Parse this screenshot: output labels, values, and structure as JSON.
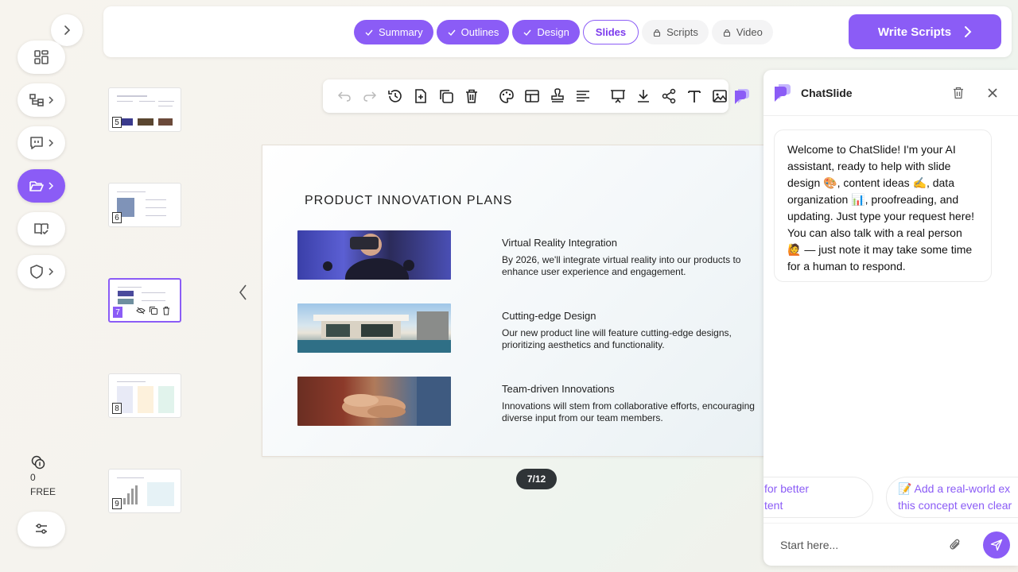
{
  "rail": {
    "credits_count": "0",
    "plan": "FREE"
  },
  "steps": [
    {
      "label": "Summary",
      "state": "done"
    },
    {
      "label": "Outlines",
      "state": "done"
    },
    {
      "label": "Design",
      "state": "done"
    },
    {
      "label": "Slides",
      "state": "current"
    },
    {
      "label": "Scripts",
      "state": "locked"
    },
    {
      "label": "Video",
      "state": "locked"
    }
  ],
  "write_scripts_label": "Write Scripts",
  "thumbnails": [
    {
      "number": "5"
    },
    {
      "number": "6"
    },
    {
      "number": "7"
    },
    {
      "number": "8"
    },
    {
      "number": "9"
    }
  ],
  "slide": {
    "title": "PRODUCT INNOVATION PLANS",
    "items": [
      {
        "title": "Virtual Reality Integration",
        "body": "By 2026, we'll integrate virtual reality into our products to enhance user experience and engagement."
      },
      {
        "title": "Cutting-edge Design",
        "body": "Our new product line will feature cutting-edge designs, prioritizing aesthetics and functionality."
      },
      {
        "title": "Team-driven Innovations",
        "body": "Innovations will stem from collaborative efforts, encouraging diverse input from our team members."
      }
    ]
  },
  "page_indicator": "7/12",
  "chat": {
    "title": "ChatSlide",
    "welcome": "Welcome to ChatSlide! I'm your AI assistant, ready to help with slide design 🎨, content ideas ✍️, data organization 📊, proofreading, and updating. Just type your request here! You can also talk with a real person 🙋 — just note it may take some time for a human to respond.",
    "suggestions": [
      "for better\ntent",
      "📝 Add a real-world ex\nthis concept even clear"
    ],
    "input_placeholder": "Start here..."
  },
  "colors": {
    "accent": "#8b5cf6",
    "pill_dark": "#2f3437"
  }
}
